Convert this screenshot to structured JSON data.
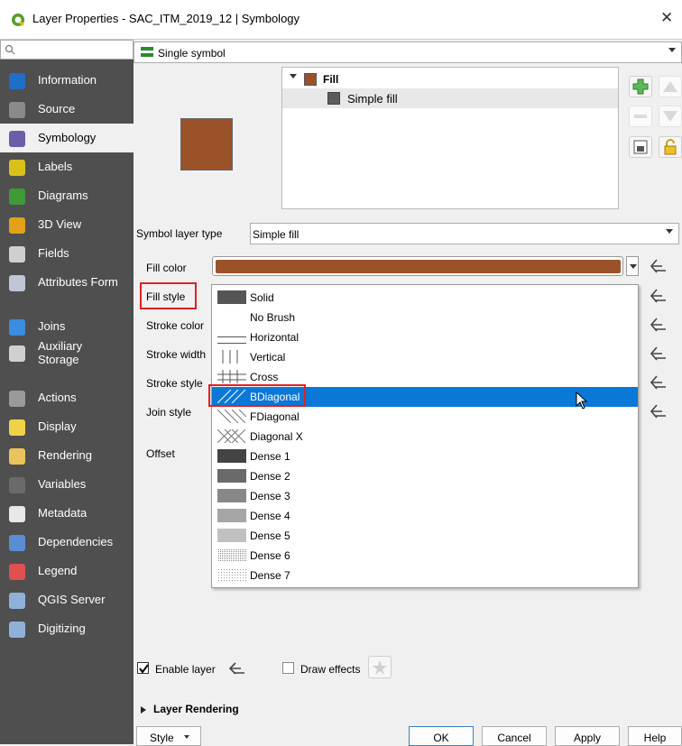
{
  "window": {
    "title": "Layer Properties - SAC_ITM_2019_12 | Symbology",
    "close_glyph": "✕"
  },
  "sidebar": {
    "search_placeholder": "",
    "items": [
      {
        "label": "Information",
        "icon": "information-icon",
        "color": "#1e6fc9"
      },
      {
        "label": "Source",
        "icon": "source-icon",
        "color": "#8a8a8a"
      },
      {
        "label": "Symbology",
        "icon": "symbology-icon",
        "color": "#6d5ca8"
      },
      {
        "label": "Labels",
        "icon": "labels-icon",
        "color": "#d8c21a"
      },
      {
        "label": "Diagrams",
        "icon": "diagrams-icon",
        "color": "#3d9a35"
      },
      {
        "label": "3D View",
        "icon": "3d-view-icon",
        "color": "#e3a019"
      },
      {
        "label": "Fields",
        "icon": "fields-icon",
        "color": "#cfcfcf"
      },
      {
        "label": "Attributes Form",
        "icon": "attributes-form-icon",
        "color": "#bfc7d4"
      },
      {
        "label": "Joins",
        "icon": "joins-icon",
        "color": "#3a8de0"
      },
      {
        "label": "Auxiliary Storage",
        "label_line1": "Auxiliary",
        "label_line2": "Storage",
        "icon": "auxiliary-storage-icon",
        "color": "#d0d0d0"
      },
      {
        "label": "Actions",
        "icon": "actions-icon",
        "color": "#9a9a9a"
      },
      {
        "label": "Display",
        "icon": "display-icon",
        "color": "#f1d14a"
      },
      {
        "label": "Rendering",
        "icon": "rendering-icon",
        "color": "#e9c45a"
      },
      {
        "label": "Variables",
        "icon": "variables-icon",
        "color": "#6a6a6a"
      },
      {
        "label": "Metadata",
        "icon": "metadata-icon",
        "color": "#e8e8e8"
      },
      {
        "label": "Dependencies",
        "icon": "dependencies-icon",
        "color": "#5b8ed1"
      },
      {
        "label": "Legend",
        "icon": "legend-icon",
        "color": "#e05050"
      },
      {
        "label": "QGIS Server",
        "icon": "qgis-server-icon",
        "color": "#8fb1d9"
      },
      {
        "label": "Digitizing",
        "icon": "digitizing-icon",
        "color": "#8fb1d9"
      }
    ],
    "active_index": 2
  },
  "renderer": {
    "selected": "Single symbol"
  },
  "symbol_tree": {
    "root_label": "Fill",
    "child_label": "Simple fill",
    "fill_color": "#9b5228",
    "child_color": "#5c5c5c"
  },
  "symbol_layer_type": {
    "label": "Symbol layer type",
    "selected": "Simple fill"
  },
  "properties": {
    "fill_color_label": "Fill color",
    "fill_style_label": "Fill style",
    "stroke_color_label": "Stroke color",
    "stroke_width_label": "Stroke width",
    "stroke_style_label": "Stroke style",
    "join_style_label": "Join style",
    "offset_label": "Offset",
    "fill_color_value": "#9b5228"
  },
  "fill_style_options": [
    {
      "label": "Solid",
      "pattern": "solid"
    },
    {
      "label": "No Brush",
      "pattern": "none"
    },
    {
      "label": "Horizontal",
      "pattern": "horizontal"
    },
    {
      "label": "Vertical",
      "pattern": "vertical"
    },
    {
      "label": "Cross",
      "pattern": "cross"
    },
    {
      "label": "BDiagonal",
      "pattern": "bdiagonal"
    },
    {
      "label": "FDiagonal",
      "pattern": "fdiagonal"
    },
    {
      "label": "Diagonal X",
      "pattern": "diagx"
    },
    {
      "label": "Dense 1",
      "pattern": "dense1"
    },
    {
      "label": "Dense 2",
      "pattern": "dense2"
    },
    {
      "label": "Dense 3",
      "pattern": "dense3"
    },
    {
      "label": "Dense 4",
      "pattern": "dense4"
    },
    {
      "label": "Dense 5",
      "pattern": "dense5"
    },
    {
      "label": "Dense 6",
      "pattern": "dense6"
    },
    {
      "label": "Dense 7",
      "pattern": "dense7"
    }
  ],
  "fill_style_highlighted_index": 5,
  "enable_layer": {
    "label": "Enable layer",
    "checked": true
  },
  "draw_effects": {
    "label": "Draw effects",
    "checked": false
  },
  "layer_rendering": {
    "label": "Layer Rendering"
  },
  "buttons": {
    "style": "Style",
    "ok": "OK",
    "cancel": "Cancel",
    "apply": "Apply",
    "help": "Help"
  },
  "colors": {
    "selection": "#0a78d7",
    "highlight_outline": "#e02020",
    "sidebar_bg": "#4f4f4f"
  }
}
